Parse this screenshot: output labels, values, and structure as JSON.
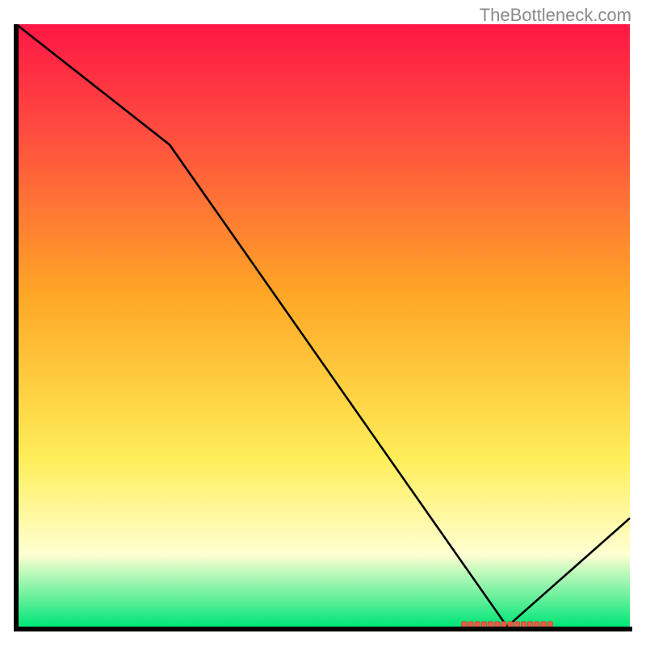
{
  "watermark": "TheBottleneck.com",
  "colors": {
    "gradient_top": "#ff1744",
    "gradient_mid_red": "#ff4d40",
    "gradient_mid_orange": "#ffa726",
    "gradient_mid_yellow": "#ffee58",
    "gradient_light_yellow": "#ffffd2",
    "gradient_bottom_green": "#00e676",
    "line": "#000000",
    "marker_fill": "#ee5a42",
    "marker_stroke": "#c74a36",
    "axis": "#000000"
  },
  "chart_data": {
    "type": "line",
    "title": "",
    "xlabel": "",
    "ylabel": "",
    "xlim": [
      0,
      100
    ],
    "ylim": [
      0,
      100
    ],
    "x": [
      0,
      25,
      80,
      100
    ],
    "values": [
      100,
      80,
      0,
      18
    ],
    "optimal_marker": {
      "x_start": 73,
      "x_end": 87,
      "y": 0
    },
    "annotations": [],
    "legend": []
  }
}
